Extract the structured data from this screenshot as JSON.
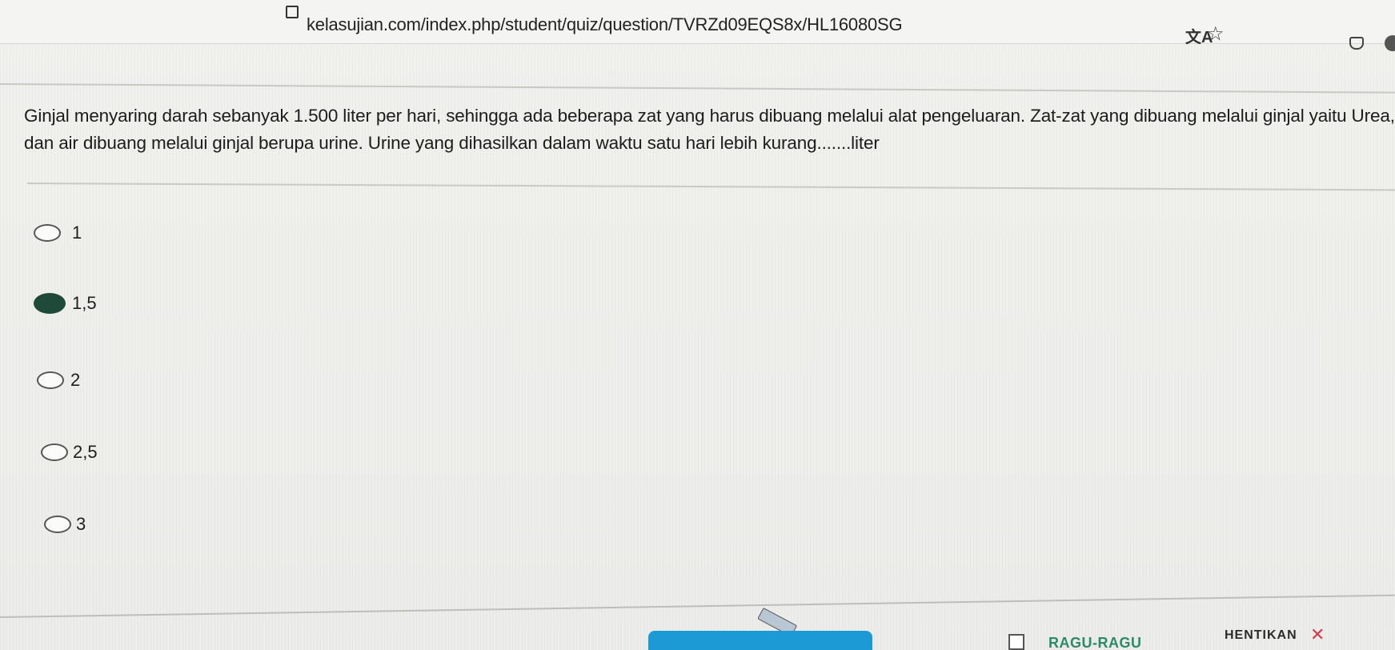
{
  "browser": {
    "url": "kelasujian.com/index.php/student/quiz/question/TVRZd09EQS8x/HL16080SG",
    "translate_icon": "translate-icon",
    "bookmark_icon": "star-icon"
  },
  "question": {
    "line1": "Ginjal menyaring darah sebanyak 1.500 liter per hari, sehingga ada beberapa zat yang harus dibuang melalui alat pengeluaran. Zat-zat yang dibuang melalui ginjal yaitu Urea, amonia,",
    "line2": "dan air dibuang melalui ginjal berupa urine. Urine yang dihasilkan dalam waktu satu hari lebih kurang.......liter"
  },
  "options": [
    {
      "label": "1",
      "selected": false
    },
    {
      "label": "1,5",
      "selected": true
    },
    {
      "label": "2",
      "selected": false
    },
    {
      "label": "2,5",
      "selected": false
    },
    {
      "label": "3",
      "selected": false
    }
  ],
  "footer": {
    "ragu_label": "RAGU-RAGU",
    "stop_label": "HENTIKAN",
    "close_symbol": "✕"
  },
  "colors": {
    "selected_radio": "#1f4a3a",
    "primary_button": "#1c9ad6",
    "ragu_text": "#2a8a6a",
    "close_icon": "#d23a4a"
  }
}
